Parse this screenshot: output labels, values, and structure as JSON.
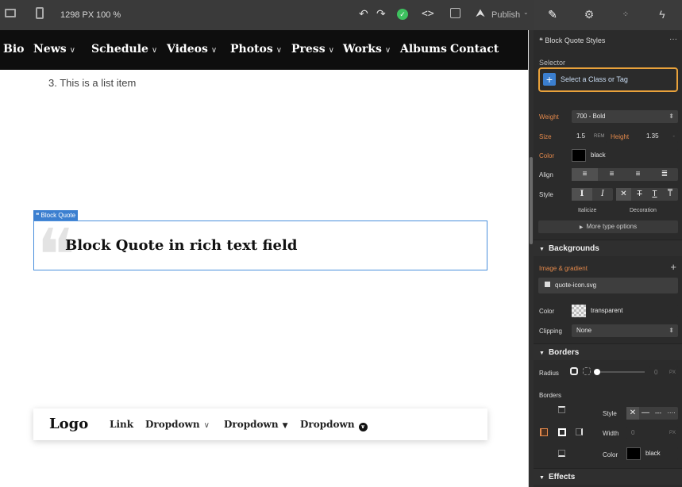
{
  "toolbar": {
    "width_label": "1298 PX",
    "zoom_label": "100 %",
    "publish_label": "Publish",
    "undo_icon": "undo-icon",
    "redo_icon": "redo-icon",
    "status_icon": "check-circle-icon",
    "code_icon": "code-icon",
    "export_icon": "export-icon",
    "publish_icon": "rocket-icon"
  },
  "site_nav": {
    "items": [
      {
        "label": "Bio",
        "dropdown": false
      },
      {
        "label": "News",
        "dropdown": true
      },
      {
        "label": "Schedule",
        "dropdown": true
      },
      {
        "label": "Videos",
        "dropdown": true
      },
      {
        "label": "Photos",
        "dropdown": true
      },
      {
        "label": "Press",
        "dropdown": true
      },
      {
        "label": "Works",
        "dropdown": true
      },
      {
        "label": "Albums",
        "dropdown": false
      },
      {
        "label": "Contact",
        "dropdown": false
      }
    ]
  },
  "content": {
    "list_item": "3. This is a list item",
    "block_quote_tag": "❝ Block Quote",
    "block_quote_text": "Block Quote in rich text field"
  },
  "footer_nav": {
    "logo": "Logo",
    "link": "Link",
    "dropdown1": "Dropdown",
    "dropdown2": "Dropdown",
    "dropdown3": "Dropdown"
  },
  "panel": {
    "tabs": [
      "style-brush-icon",
      "settings-gear-icon",
      "interactions-icon",
      "lightning-icon"
    ],
    "header": "❝ Block Quote Styles",
    "header_more": "···",
    "selector_label": "Selector",
    "selector_placeholder": "Select a Class or Tag",
    "typography": {
      "weight_label": "Weight",
      "weight_value": "700 - Bold",
      "size_label": "Size",
      "size_value": "1.5",
      "size_unit": "REM",
      "height_label": "Height",
      "height_value": "1.35",
      "color_label": "Color",
      "color_value": "black",
      "align_label": "Align",
      "style_label": "Style",
      "italicize_label": "Italicize",
      "decoration_label": "Decoration",
      "more_label": "More type options"
    },
    "backgrounds": {
      "title": "Backgrounds",
      "image_label": "Image & gradient",
      "image_file": "quote-icon.svg",
      "color_label": "Color",
      "color_value": "transparent",
      "clipping_label": "Clipping",
      "clipping_value": "None"
    },
    "borders": {
      "title": "Borders",
      "radius_label": "Radius",
      "radius_value": "0",
      "radius_unit": "PX",
      "borders_label": "Borders",
      "style_label": "Style",
      "width_label": "Width",
      "width_value": "0",
      "width_unit": "PX",
      "color_label": "Color",
      "color_value": "black"
    },
    "effects": {
      "title": "Effects"
    }
  },
  "colors": {
    "accent_orange": "#e4894b",
    "selection_blue": "#3b7fd0",
    "publish_green": "#3ec15f"
  }
}
